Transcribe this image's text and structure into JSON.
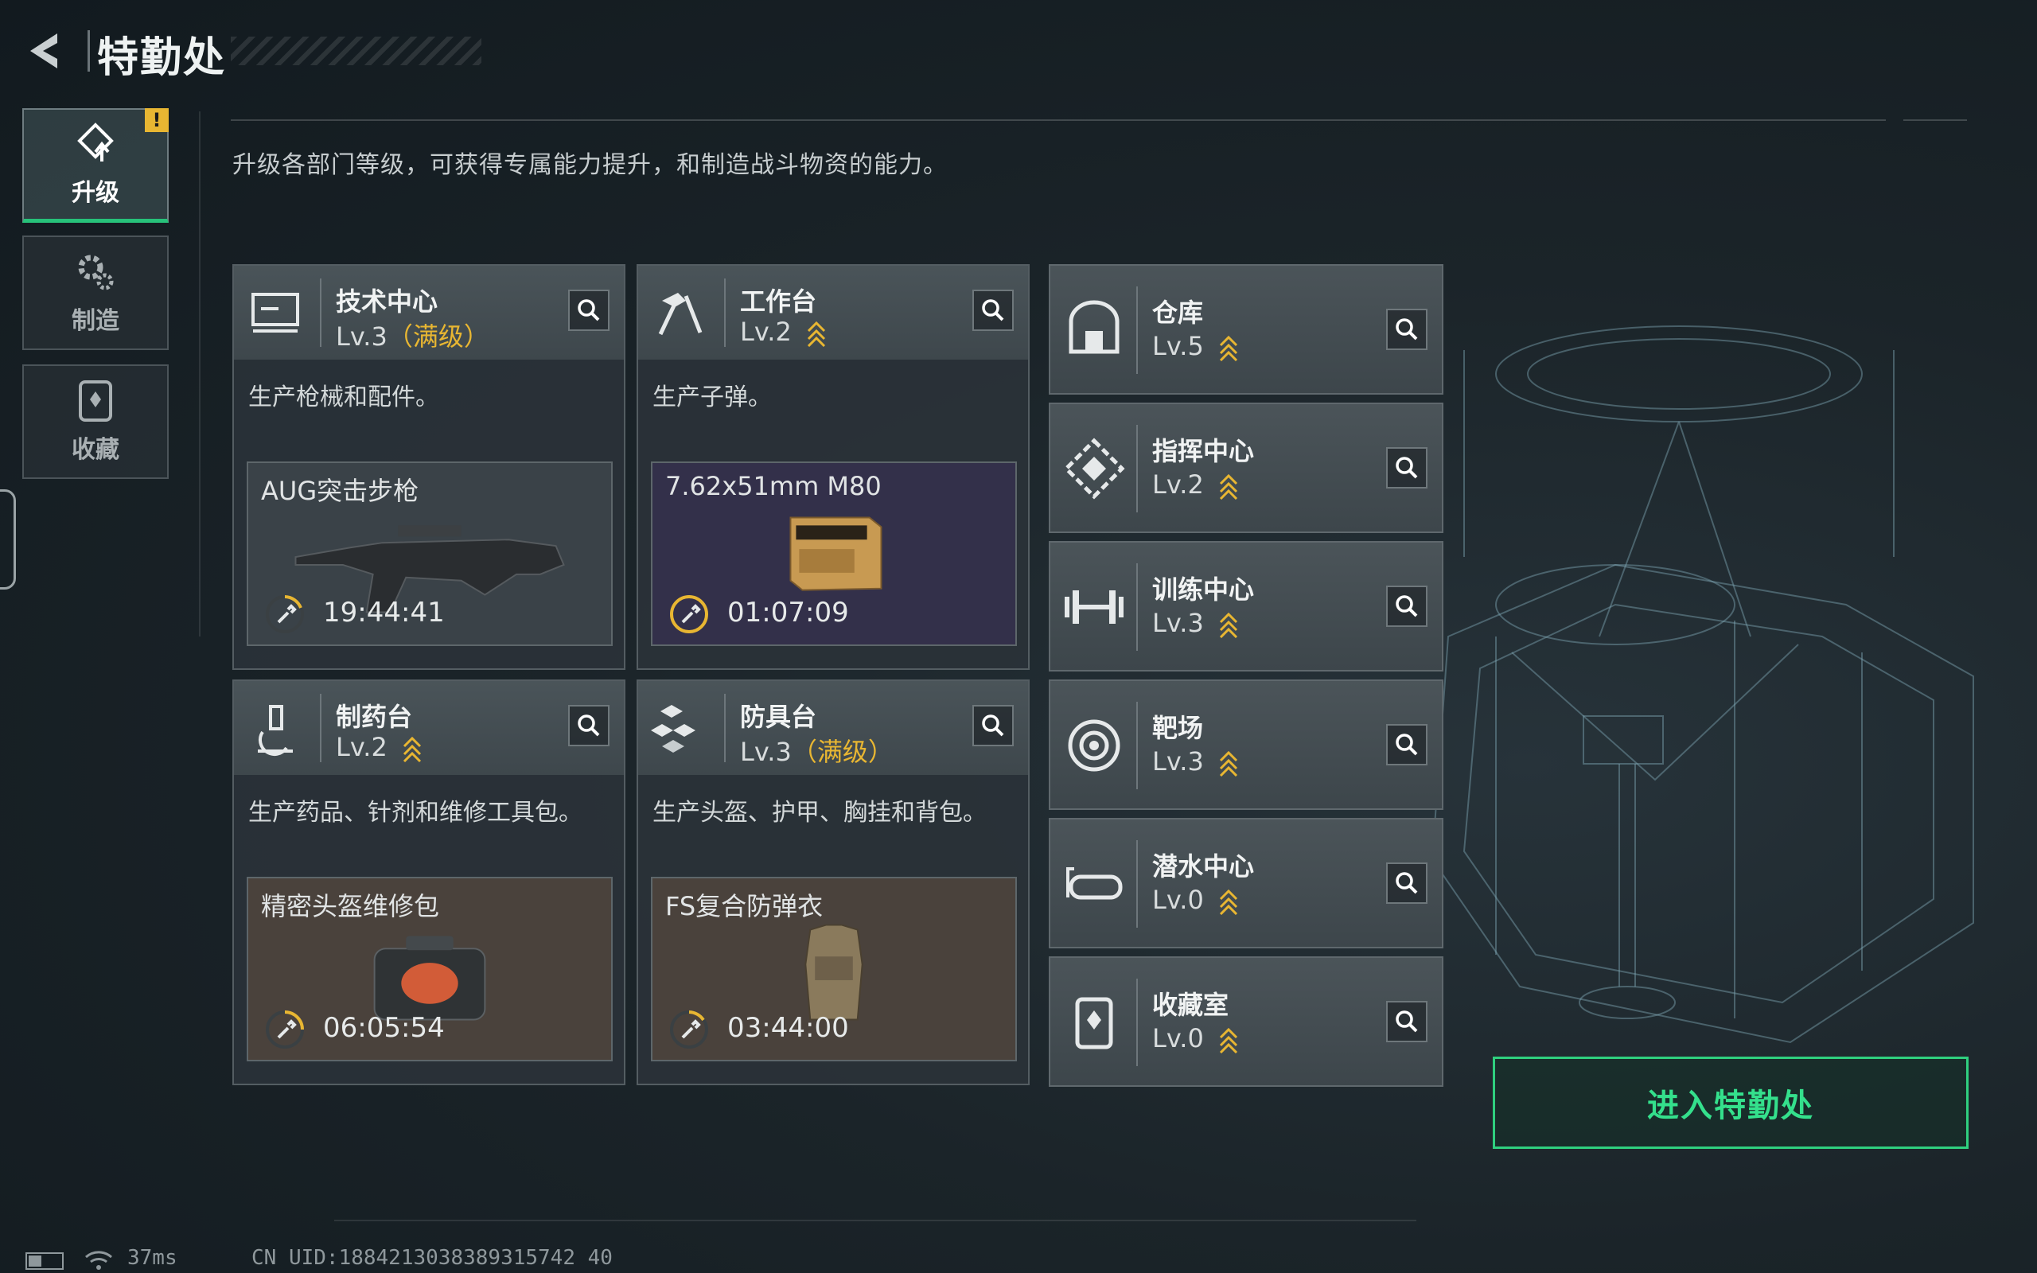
{
  "header": {
    "title": "特勤处"
  },
  "sidebar": {
    "items": [
      {
        "label": "升级",
        "icon": "upgrade-icon",
        "active": true,
        "badge": "!"
      },
      {
        "label": "制造",
        "icon": "gear-icon",
        "active": false
      },
      {
        "label": "收藏",
        "icon": "collection-icon",
        "active": false
      }
    ]
  },
  "description": "升级各部门等级，可获得专属能力提升，和制造战斗物资的能力。",
  "cards": [
    {
      "name": "技术中心",
      "level": "Lv.3",
      "max_label": "（满级）",
      "desc": "生产枪械和配件。",
      "craft_name": "AUG突击步枪",
      "timer": "19:44:41",
      "craft_bg": "#3a4248"
    },
    {
      "name": "工作台",
      "level": "Lv.2",
      "desc": "生产子弹。",
      "craft_name": "7.62x51mm M80",
      "timer": "01:07:09",
      "craft_bg": "#33304a"
    },
    {
      "name": "制药台",
      "level": "Lv.2",
      "desc": "生产药品、针剂和维修工具包。",
      "craft_name": "精密头盔维修包",
      "timer": "06:05:54",
      "craft_bg": "#4a423c"
    },
    {
      "name": "防具台",
      "level": "Lv.3",
      "max_label": "（满级）",
      "desc": "生产头盔、护甲、胸挂和背包。",
      "craft_name": "FS复合防弹衣",
      "timer": "03:44:00",
      "craft_bg": "#4a423c"
    }
  ],
  "buildings": [
    {
      "name": "仓库",
      "level": "Lv.5",
      "icon": "warehouse-icon"
    },
    {
      "name": "指挥中心",
      "level": "Lv.2",
      "icon": "command-center-icon"
    },
    {
      "name": "训练中心",
      "level": "Lv.3",
      "icon": "dumbbell-icon"
    },
    {
      "name": "靶场",
      "level": "Lv.3",
      "icon": "target-icon"
    },
    {
      "name": "潜水中心",
      "level": "Lv.0",
      "icon": "diving-mask-icon"
    },
    {
      "name": "收藏室",
      "level": "Lv.0",
      "icon": "collection-room-icon"
    }
  ],
  "enter_button": "进入特勤处",
  "status": {
    "ping": "37ms",
    "uid": "CN UID:1884213038389315742 40"
  },
  "colors": {
    "accent_green": "#2fd07f",
    "gold": "#e8b632"
  }
}
